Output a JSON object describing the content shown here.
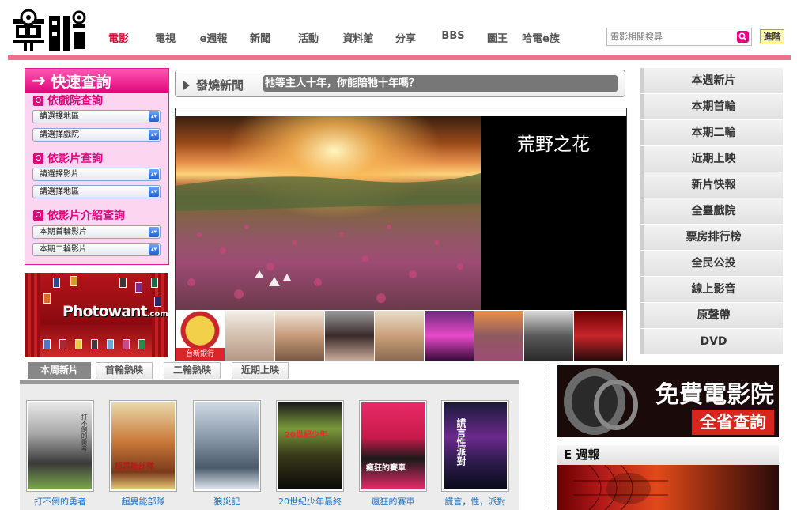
{
  "header": {
    "nav_items": [
      "電影",
      "電視",
      "e週報",
      "新聞",
      "活動",
      "資料館",
      "分享",
      "BBS",
      "圖王",
      "哈電e族"
    ],
    "active_nav": "電影",
    "search_placeholder": "電影相關搜尋",
    "advanced_label": "進階"
  },
  "quick_search": {
    "title": "快速查詢",
    "by_cinema": {
      "heading": "依戲院查詢",
      "selects": [
        "請選擇地區",
        "請選擇戲院"
      ]
    },
    "by_movie": {
      "heading": "依影片查詢",
      "selects": [
        "請選擇影片",
        "請選擇地區"
      ]
    },
    "by_intro": {
      "heading": "依影片介紹查詢",
      "selects": [
        "本期首輪影片",
        "本期二輪影片"
      ]
    }
  },
  "photowant": {
    "logo_main": "Photowant",
    "logo_suffix": ".com"
  },
  "hot_news": {
    "label": "發燒新聞",
    "ticker": "牠等主人十年，你能陪牠十年嗎？"
  },
  "feature": {
    "caption": "荒野之花",
    "thumb_badge": "台新銀行"
  },
  "right_menu": {
    "items": [
      "本週新片",
      "本期首輪",
      "本期二輪",
      "近期上映",
      "新片快報",
      "全臺戲院",
      "票房排行榜",
      "全民公投",
      "線上影音",
      "原聲帶",
      "DVD"
    ]
  },
  "movie_tabs": {
    "tabs": [
      "本周新片",
      "首輪熱映",
      "二輪熱映",
      "近期上映"
    ],
    "active_index": 0
  },
  "movies": [
    {
      "title": "打不倒的勇者",
      "poster_text": "打不倒的勇者"
    },
    {
      "title": "超異能部隊",
      "poster_text": "超異能部隊"
    },
    {
      "title": "狼災記",
      "poster_text": ""
    },
    {
      "title": "20世紀少年最終",
      "poster_text": "20世紀少年"
    },
    {
      "title": "瘋狂的賽車",
      "poster_text": "瘋狂的賽車"
    },
    {
      "title": "謊言，性，派對",
      "poster_text": "謊言性派對"
    }
  ],
  "cinema_banner": {
    "title": "免費電影院",
    "subtitle": "全省查詢"
  },
  "eweekly": {
    "title": "E 週報"
  },
  "colors": {
    "brand_pink": "#e0067a",
    "header_bar": "#ef6f8e",
    "active_nav": "#d6103a",
    "link_blue": "#1a6fc5"
  }
}
